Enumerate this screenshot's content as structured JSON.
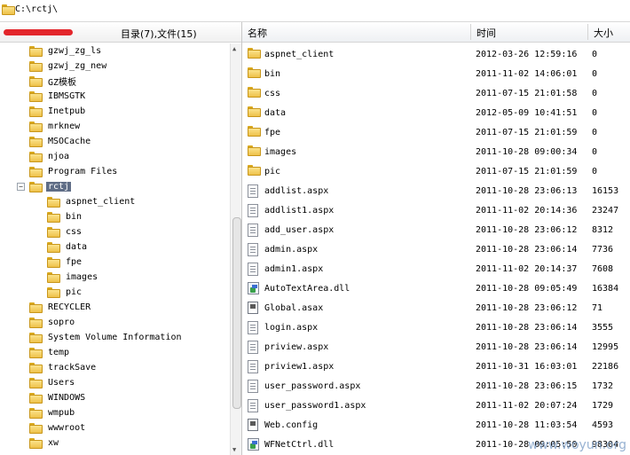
{
  "address_bar": {
    "path": "C:\\rctj\\"
  },
  "left_pane": {
    "summary": "目录(7),文件(15)",
    "tree": [
      {
        "label": "gzwj_zg_ls",
        "level": 0
      },
      {
        "label": "gzwj_zg_new",
        "level": 0
      },
      {
        "label": "GZ模板",
        "level": 0
      },
      {
        "label": "IBMSGTK",
        "level": 0
      },
      {
        "label": "Inetpub",
        "level": 0
      },
      {
        "label": "mrknew",
        "level": 0
      },
      {
        "label": "MSOCache",
        "level": 0
      },
      {
        "label": "njoa",
        "level": 0
      },
      {
        "label": "Program Files",
        "level": 0
      },
      {
        "label": "rctj",
        "level": 0,
        "selected": true,
        "expander": "−"
      },
      {
        "label": "aspnet_client",
        "level": 1
      },
      {
        "label": "bin",
        "level": 1
      },
      {
        "label": "css",
        "level": 1
      },
      {
        "label": "data",
        "level": 1
      },
      {
        "label": "fpe",
        "level": 1
      },
      {
        "label": "images",
        "level": 1
      },
      {
        "label": "pic",
        "level": 1
      },
      {
        "label": "RECYCLER",
        "level": 0
      },
      {
        "label": "sopro",
        "level": 0
      },
      {
        "label": "System Volume Information",
        "level": 0
      },
      {
        "label": "temp",
        "level": 0
      },
      {
        "label": "trackSave",
        "level": 0
      },
      {
        "label": "Users",
        "level": 0
      },
      {
        "label": "WINDOWS",
        "level": 0
      },
      {
        "label": "wmpub",
        "level": 0
      },
      {
        "label": "wwwroot",
        "level": 0
      },
      {
        "label": "xw",
        "level": 0
      }
    ]
  },
  "file_list": {
    "columns": {
      "name": "名称",
      "time": "时间",
      "size": "大小"
    },
    "rows": [
      {
        "name": "aspnet_client",
        "time": "2012-03-26 12:59:16",
        "size": "0",
        "icon": "folder-icon"
      },
      {
        "name": "bin",
        "time": "2011-11-02 14:06:01",
        "size": "0",
        "icon": "folder-icon"
      },
      {
        "name": "css",
        "time": "2011-07-15 21:01:58",
        "size": "0",
        "icon": "folder-icon"
      },
      {
        "name": "data",
        "time": "2012-05-09 10:41:51",
        "size": "0",
        "icon": "folder-icon"
      },
      {
        "name": "fpe",
        "time": "2011-07-15 21:01:59",
        "size": "0",
        "icon": "folder-icon"
      },
      {
        "name": "images",
        "time": "2011-10-28 09:00:34",
        "size": "0",
        "icon": "folder-icon"
      },
      {
        "name": "pic",
        "time": "2011-07-15 21:01:59",
        "size": "0",
        "icon": "folder-icon"
      },
      {
        "name": "addlist.aspx",
        "time": "2011-10-28 23:06:13",
        "size": "16153",
        "icon": "document-icon"
      },
      {
        "name": "addlist1.aspx",
        "time": "2011-11-02 20:14:36",
        "size": "23247",
        "icon": "document-icon"
      },
      {
        "name": "add_user.aspx",
        "time": "2011-10-28 23:06:12",
        "size": "8312",
        "icon": "document-icon"
      },
      {
        "name": "admin.aspx",
        "time": "2011-10-28 23:06:14",
        "size": "7736",
        "icon": "document-icon"
      },
      {
        "name": "admin1.aspx",
        "time": "2011-11-02 20:14:37",
        "size": "7608",
        "icon": "document-icon"
      },
      {
        "name": "AutoTextArea.dll",
        "time": "2011-10-28 09:05:49",
        "size": "16384",
        "icon": "dll-icon"
      },
      {
        "name": "Global.asax",
        "time": "2011-10-28 23:06:12",
        "size": "71",
        "icon": "config-icon"
      },
      {
        "name": "login.aspx",
        "time": "2011-10-28 23:06:14",
        "size": "3555",
        "icon": "document-icon"
      },
      {
        "name": "priview.aspx",
        "time": "2011-10-28 23:06:14",
        "size": "12995",
        "icon": "document-icon"
      },
      {
        "name": "priview1.aspx",
        "time": "2011-10-31 16:03:01",
        "size": "22186",
        "icon": "document-icon"
      },
      {
        "name": "user_password.aspx",
        "time": "2011-10-28 23:06:15",
        "size": "1732",
        "icon": "document-icon"
      },
      {
        "name": "user_password1.aspx",
        "time": "2011-11-02 20:07:24",
        "size": "1729",
        "icon": "document-icon"
      },
      {
        "name": "Web.config",
        "time": "2011-10-28 11:03:54",
        "size": "4593",
        "icon": "config-icon"
      },
      {
        "name": "WFNetCtrl.dll",
        "time": "2011-10-28 09:05:50",
        "size": "98304",
        "icon": "dll-icon"
      }
    ]
  },
  "watermark": "www.woyun.org"
}
